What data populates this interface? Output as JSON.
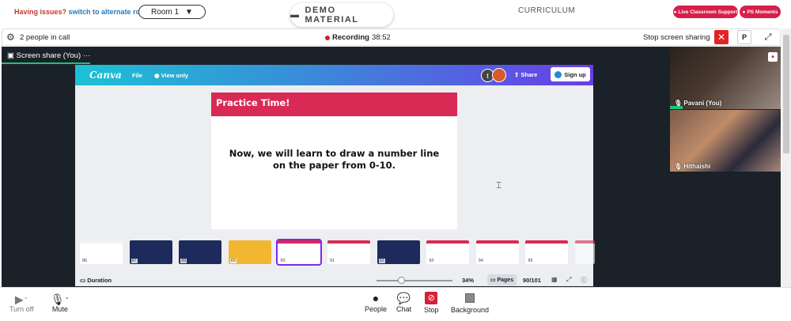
{
  "topbar": {
    "issue_label": "Having issues?",
    "switch_link": "switch to alternate room",
    "room_label": "Room 1",
    "demo_label": "DEMO MATERIAL",
    "curriculum_label": "CURRICULUM",
    "live_support": "Live Classroom Support",
    "ps_moments": "PS Moments"
  },
  "callbar": {
    "people_count": "2 people in call",
    "recording_label": "Recording",
    "recording_time": "38:52",
    "stop_sharing": "Stop screen sharing",
    "p_button": "P"
  },
  "share_tab": {
    "label": "Screen share (You)"
  },
  "canva": {
    "logo": "Canva",
    "file": "File",
    "view_only": "View only",
    "avatar_initial": "t",
    "share": "Share",
    "sign_up": "Sign up",
    "slide_title": "Practice Time!",
    "slide_text": "Now, we will learn to draw a number line on the paper from 0-10.",
    "duration": "Duration",
    "zoom": "34%",
    "pages": "Pages",
    "page_count": "90/101",
    "thumbnails": [
      {
        "num": "86",
        "color": "#f3f3f3"
      },
      {
        "num": "87",
        "color": "#1c2a5c"
      },
      {
        "num": "88",
        "color": "#1c2a5c"
      },
      {
        "num": "89",
        "color": "#f2b632"
      },
      {
        "num": "90",
        "color": "#d82a55"
      },
      {
        "num": "91",
        "color": "#d82a55"
      },
      {
        "num": "92",
        "color": "#1c2a5c"
      },
      {
        "num": "93",
        "color": "#d82a55"
      },
      {
        "num": "94",
        "color": "#d82a55"
      },
      {
        "num": "95",
        "color": "#d82a55"
      },
      {
        "num": "",
        "color": "#d82a55"
      }
    ]
  },
  "videos": [
    {
      "name": "Pavani (You)"
    },
    {
      "name": "Hithaishi"
    }
  ],
  "controls": {
    "turn_off": "Turn off",
    "mute": "Mute",
    "people": "People",
    "chat": "Chat",
    "stop": "Stop",
    "background": "Background"
  }
}
